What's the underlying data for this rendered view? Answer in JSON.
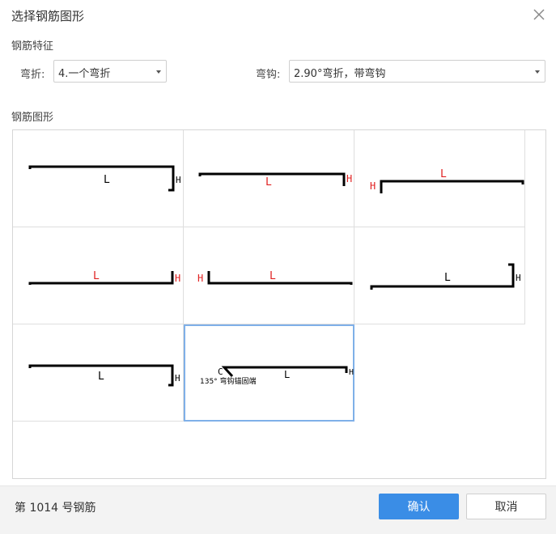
{
  "dialog": {
    "title": "选择钢筋图形",
    "close_icon": "close-icon"
  },
  "features": {
    "section_label": "钢筋特征",
    "bend_label": "弯折:",
    "bend_value": "4.一个弯折",
    "hook_label": "弯钩:",
    "hook_value": "2.90°弯折，带弯钩"
  },
  "shapes": {
    "section_label": "钢筋图形",
    "items": [
      {
        "l_label": "L",
        "h_label": "H",
        "label_color": "#000000"
      },
      {
        "l_label": "L",
        "h_label": "H",
        "label_color": "#e02020"
      },
      {
        "l_label": "L",
        "h_label": "H",
        "label_color": "#e02020"
      },
      {
        "l_label": "L",
        "h_label": "H",
        "label_color": "#e02020"
      },
      {
        "l_label": "L",
        "h_label": "H",
        "label_color": "#e02020"
      },
      {
        "l_label": "L",
        "h_label": "H",
        "label_color": "#000000"
      },
      {
        "l_label": "L",
        "h_label": "H",
        "label_color": "#000000"
      },
      {
        "l_label": "L",
        "h_label": "H",
        "label_color": "#000000",
        "c_label": "C",
        "note": "135° 弯钩锚固端",
        "selected": true
      }
    ]
  },
  "footer": {
    "status": "第 1014 号钢筋",
    "confirm_label": "确认",
    "cancel_label": "取消"
  },
  "colors": {
    "accent": "#3a8de6",
    "selected_border": "#7fb0e8",
    "label_red": "#e02020"
  }
}
